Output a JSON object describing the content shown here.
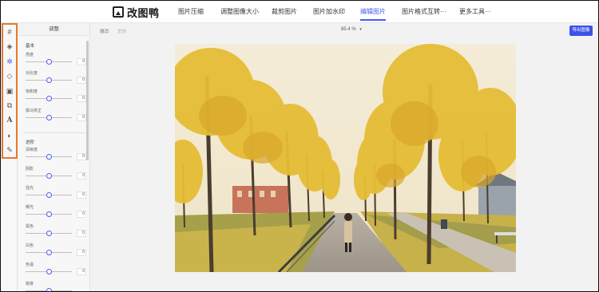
{
  "app": {
    "logo_text": "改图鸭",
    "nav": [
      {
        "label": "图片压缩",
        "active": false
      },
      {
        "label": "调整图像大小",
        "active": false
      },
      {
        "label": "裁剪图片",
        "active": false
      },
      {
        "label": "图片加水印",
        "active": false
      },
      {
        "label": "编辑图片",
        "active": true
      },
      {
        "label": "图片格式互转···",
        "active": false
      },
      {
        "label": "更多工具···",
        "active": false
      }
    ]
  },
  "toolbar": {
    "tools": [
      {
        "icon": "hash-icon",
        "active": false
      },
      {
        "icon": "drop-icon",
        "active": false
      },
      {
        "icon": "adjust-icon",
        "active": true
      },
      {
        "icon": "drop-outline-icon",
        "active": false
      },
      {
        "icon": "frame-icon",
        "active": false
      },
      {
        "icon": "crop-icon",
        "active": false
      },
      {
        "icon": "text-icon",
        "active": false
      },
      {
        "icon": "palette-icon",
        "active": false
      },
      {
        "icon": "brush-icon",
        "active": false
      }
    ]
  },
  "panel": {
    "title": "调整",
    "basic": {
      "title": "基本",
      "sliders": [
        {
          "label": "亮度",
          "value": "0",
          "level": 0.5
        },
        {
          "label": "对比度",
          "value": "0",
          "level": 0.5
        },
        {
          "label": "饱和度",
          "value": "0",
          "level": 0.5
        },
        {
          "label": "伽马校正",
          "value": "0",
          "level": 0.5
        }
      ]
    },
    "advanced": {
      "title": "进阶",
      "sliders": [
        {
          "label": "清晰度",
          "value": "0",
          "level": 0.5
        },
        {
          "label": "阴影",
          "value": "0",
          "level": 0.5
        },
        {
          "label": "强光",
          "value": "0",
          "level": 0.5
        },
        {
          "label": "曝光",
          "value": "0",
          "level": 0.5
        },
        {
          "label": "黑色",
          "value": "0",
          "level": 0.5
        },
        {
          "label": "白色",
          "value": "0",
          "level": 0.5
        },
        {
          "label": "色温",
          "value": "0",
          "level": 0.5
        },
        {
          "label": "锐度",
          "value": "",
          "level": 0.5
        }
      ]
    }
  },
  "canvas": {
    "undo": "撤消",
    "redo": "重做",
    "zoom": "85.4 %",
    "export": "导出图像"
  },
  "colors": {
    "accent": "#4a5cf0",
    "toolbar_highlight": "#e8772e",
    "export_button": "#3d52e8"
  }
}
